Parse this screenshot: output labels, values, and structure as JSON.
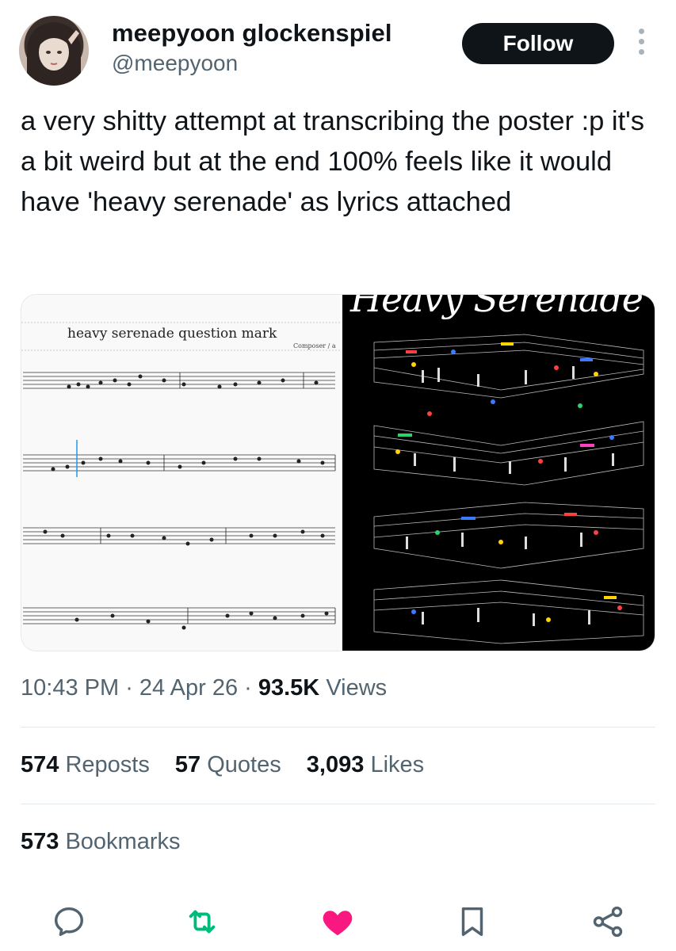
{
  "author": {
    "name": "meepyoon glockenspiel",
    "handle": "@meepyoon",
    "follow_label": "Follow"
  },
  "tweet": {
    "text": "a very shitty attempt at transcribing the poster :p it's a bit weird but at the end 100% feels like it would have 'heavy serenade' as lyrics attached"
  },
  "media": {
    "score_title": "heavy serenade question mark",
    "score_composer": "Composer / a",
    "poster_title": "Heavy Serenade"
  },
  "meta": {
    "time": "10:43 PM",
    "date": "24 Apr 26",
    "views_count": "93.5K",
    "views_label": "Views"
  },
  "stats": {
    "reposts_count": "574",
    "reposts_label": "Reposts",
    "quotes_count": "57",
    "quotes_label": "Quotes",
    "likes_count": "3,093",
    "likes_label": "Likes",
    "bookmarks_count": "573",
    "bookmarks_label": "Bookmarks"
  },
  "colors": {
    "accent_like": "#f91880",
    "accent_repost": "#00ba7c",
    "muted": "#536471"
  }
}
